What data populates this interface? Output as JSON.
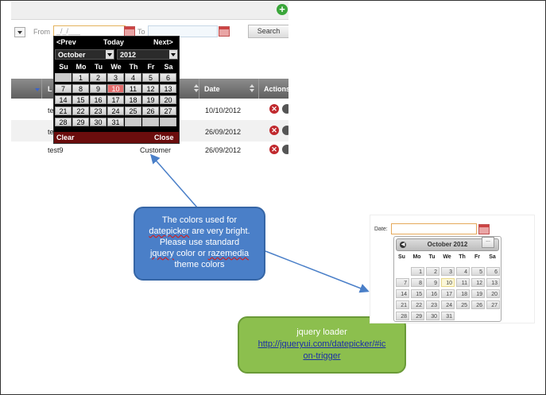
{
  "screenshot1": {
    "filter": {
      "from_label": "From",
      "from_value": "_/_/___",
      "to_label": "To",
      "search_label": "Search"
    },
    "table": {
      "headers": {
        "col1": "L",
        "date": "Date",
        "actions": "Actions"
      },
      "rows": [
        {
          "name": "te",
          "date": "10/10/2012"
        },
        {
          "name": "te",
          "date": "26/09/2012"
        },
        {
          "name": "test9",
          "type": "Customer",
          "date": "26/09/2012"
        }
      ]
    },
    "datepicker": {
      "prev": "<Prev",
      "today": "Today",
      "next": "Next>",
      "month": "October",
      "year": "2012",
      "weekdays": [
        "Su",
        "Mo",
        "Tu",
        "We",
        "Th",
        "Fr",
        "Sa"
      ],
      "weeks": [
        [
          "",
          "1",
          "2",
          "3",
          "4",
          "5",
          "6"
        ],
        [
          "7",
          "8",
          "9",
          "10",
          "11",
          "12",
          "13"
        ],
        [
          "14",
          "15",
          "16",
          "17",
          "18",
          "19",
          "20"
        ],
        [
          "21",
          "22",
          "23",
          "24",
          "25",
          "26",
          "27"
        ],
        [
          "28",
          "29",
          "30",
          "31",
          "",
          "",
          ""
        ]
      ],
      "today_day": "10",
      "clear": "Clear",
      "close": "Close"
    }
  },
  "callout_blue": {
    "line1": "The colors used for",
    "line2a": "datepicker",
    "line2b": " are very bright.",
    "line3": "Please use standard",
    "line4a": "jquery",
    "line4b": " color or ",
    "line4c": "razemedia",
    "line5": "theme  colors",
    "color": "#4a7fc8"
  },
  "callout_green": {
    "line1": "jquery loader",
    "link_line1": "http://jqueryui.com/datepicker/#ic",
    "link_line2": "on-trigger",
    "color": "#8cbf4e"
  },
  "screenshot2": {
    "date_label": "Date:",
    "trigger_label": "...",
    "datepicker": {
      "title": "October 2012",
      "weekdays": [
        "Su",
        "Mo",
        "Tu",
        "We",
        "Th",
        "Fr",
        "Sa"
      ],
      "weeks": [
        [
          "",
          "1",
          "2",
          "3",
          "4",
          "5",
          "6"
        ],
        [
          "7",
          "8",
          "9",
          "10",
          "11",
          "12",
          "13"
        ],
        [
          "14",
          "15",
          "16",
          "17",
          "18",
          "19",
          "20"
        ],
        [
          "21",
          "22",
          "23",
          "24",
          "25",
          "26",
          "27"
        ],
        [
          "28",
          "29",
          "30",
          "31",
          "",
          "",
          ""
        ]
      ],
      "today_day": "10"
    }
  }
}
